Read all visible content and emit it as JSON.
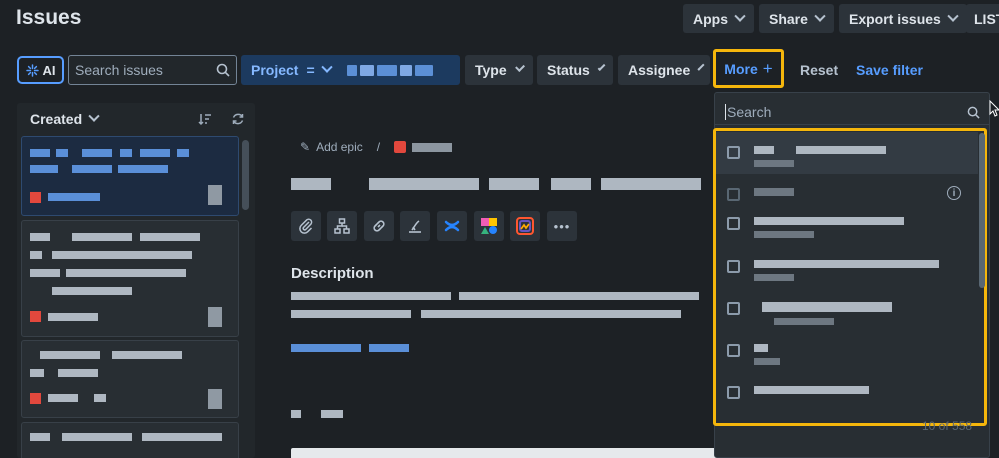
{
  "header": {
    "title": "Issues",
    "apps_label": "Apps",
    "share_label": "Share",
    "export_label": "Export issues",
    "list_label": "LIST"
  },
  "filters": {
    "ai_label": "AI",
    "search_placeholder": "Search issues",
    "project_label": "Project",
    "project_operator": "=",
    "type_label": "Type",
    "status_label": "Status",
    "assignee_label": "Assignee",
    "more_label": "More",
    "more_icon": "+",
    "reset_label": "Reset",
    "save_filter_label": "Save filter"
  },
  "list": {
    "sort_label": "Created"
  },
  "detail": {
    "add_epic_label": "Add epic",
    "breadcrumb_sep": "/",
    "description_heading": "Description",
    "more_icon": "•••"
  },
  "dropdown": {
    "search_placeholder": "Search",
    "count_label": "10 of 558",
    "info_icon": "i"
  },
  "colors": {
    "accent": "#579dff",
    "highlight": "#f5b60c",
    "background": "#1d2125"
  }
}
